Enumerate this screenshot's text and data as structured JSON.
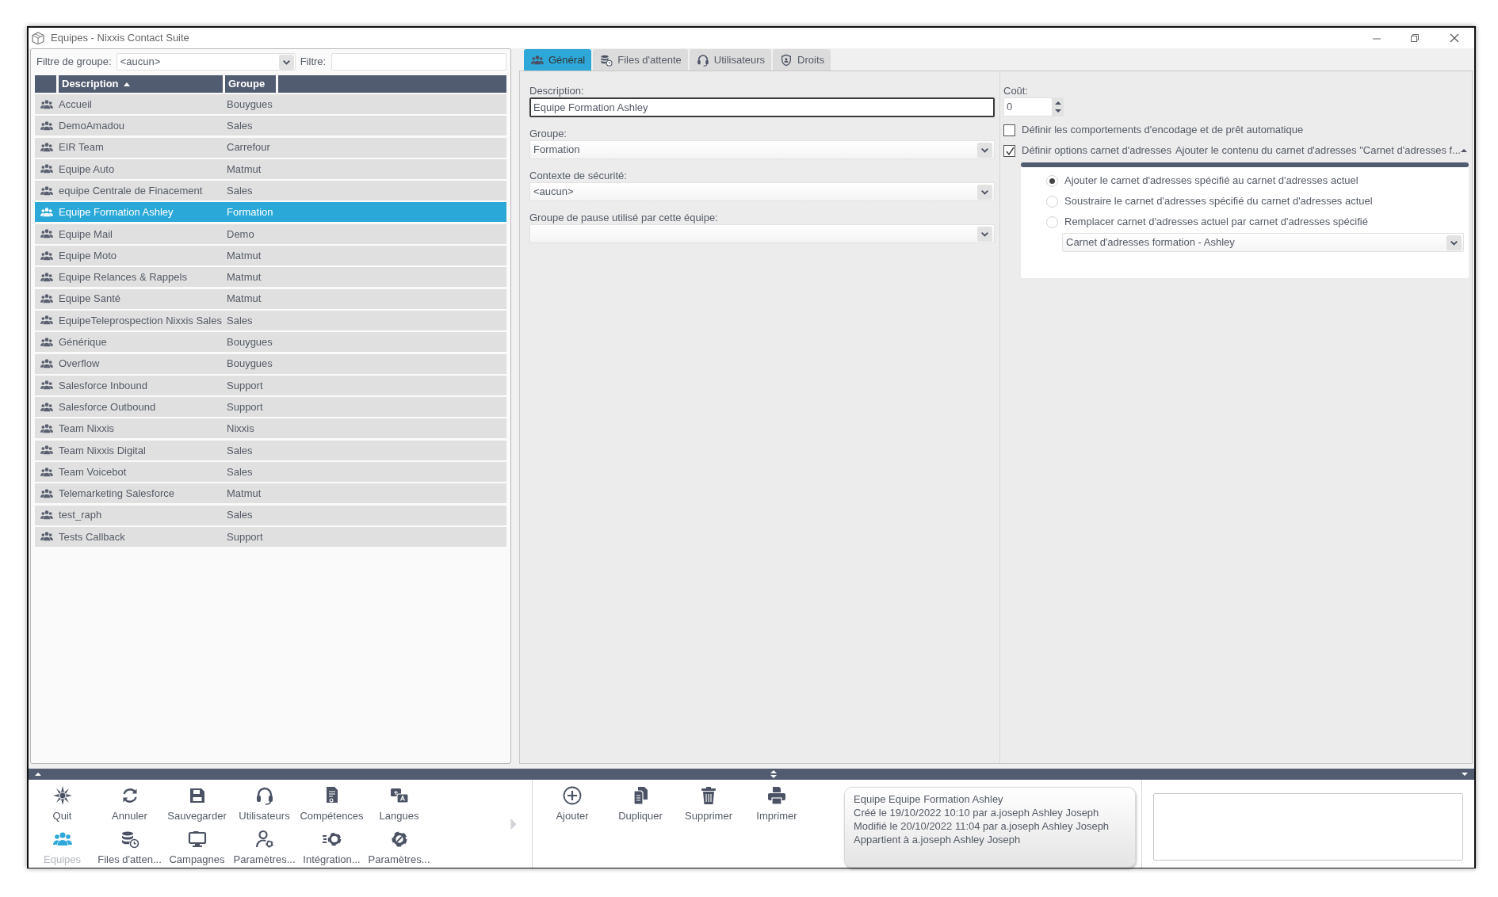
{
  "window": {
    "title": "Equipes - Nixxis Contact Suite"
  },
  "filter_bar": {
    "group_filter_label": "Filtre de groupe:",
    "group_filter_value": "<aucun>",
    "filter_label": "Filtre:"
  },
  "table": {
    "columns": [
      {
        "label": "Description",
        "sorted": true
      },
      {
        "label": "Groupe",
        "sorted": false
      }
    ],
    "rows": [
      {
        "description": "Accueil",
        "group": "Bouygues",
        "selected": false
      },
      {
        "description": "DemoAmadou",
        "group": "Sales",
        "selected": false
      },
      {
        "description": "EIR Team",
        "group": "Carrefour",
        "selected": false
      },
      {
        "description": "Equipe Auto",
        "group": "Matmut",
        "selected": false
      },
      {
        "description": "equipe Centrale de Finacement",
        "group": "Sales",
        "selected": false
      },
      {
        "description": "Equipe Formation Ashley",
        "group": "Formation",
        "selected": true
      },
      {
        "description": "Equipe Mail",
        "group": "Demo",
        "selected": false
      },
      {
        "description": "Equipe Moto",
        "group": "Matmut",
        "selected": false
      },
      {
        "description": "Equipe Relances & Rappels",
        "group": "Matmut",
        "selected": false
      },
      {
        "description": "Equipe Santé",
        "group": "Matmut",
        "selected": false
      },
      {
        "description": "EquipeTeleprospection Nixxis Sales",
        "group": "Sales",
        "selected": false
      },
      {
        "description": "Générique",
        "group": "Bouygues",
        "selected": false
      },
      {
        "description": "Overflow",
        "group": "Bouygues",
        "selected": false
      },
      {
        "description": "Salesforce Inbound",
        "group": "Support",
        "selected": false
      },
      {
        "description": "Salesforce Outbound",
        "group": "Support",
        "selected": false
      },
      {
        "description": "Team Nixxis",
        "group": "Nixxis",
        "selected": false
      },
      {
        "description": "Team Nixxis Digital",
        "group": "Sales",
        "selected": false
      },
      {
        "description": "Team Voicebot",
        "group": "Sales",
        "selected": false
      },
      {
        "description": "Telemarketing Salesforce",
        "group": "Matmut",
        "selected": false
      },
      {
        "description": "test_raph",
        "group": "Sales",
        "selected": false
      },
      {
        "description": "Tests Callback",
        "group": "Support",
        "selected": false
      }
    ]
  },
  "tabs": [
    {
      "label": "Général",
      "kind": "people",
      "selected": true
    },
    {
      "label": "Files d'attente",
      "kind": "database",
      "selected": false
    },
    {
      "label": "Utilisateurs",
      "kind": "headset",
      "selected": false
    },
    {
      "label": "Droits",
      "kind": "shield",
      "selected": false
    }
  ],
  "general": {
    "fields": [
      {
        "label": "Description:",
        "value": "Equipe Formation Ashley",
        "kind": "input"
      },
      {
        "label": "Groupe:",
        "value": "Formation",
        "kind": "select"
      },
      {
        "label": "Contexte de sécurité:",
        "value": "<aucun>",
        "kind": "select"
      },
      {
        "label": "Groupe de pause utilisé par cette équipe:",
        "kind": "select"
      }
    ],
    "cost": {
      "label": "Coût:",
      "value": "0"
    },
    "options": [
      {
        "label": "Définir les comportements d'encodage et de prêt automatique",
        "checked": false
      },
      {
        "label": "Définir options carnet d'adresses",
        "checked": true,
        "summary": "Ajouter le contenu du carnet d'adresses \"Carnet d'adresses f...",
        "expanded": true
      }
    ],
    "address_book": {
      "radios": [
        {
          "label": "Ajouter le carnet d'adresses spécifié au carnet d'adresses actuel",
          "selected": true
        },
        {
          "label": "Soustraire le carnet d'adresses spécifié du carnet d'adresses actuel",
          "selected": false
        },
        {
          "label": "Remplacer carnet d'adresses actuel par carnet d'adresses spécifié",
          "selected": false
        }
      ],
      "select_value": "Carnet d'adresses formation - Ashley"
    }
  },
  "toolbar": {
    "buttons": [
      {
        "label": "Quit",
        "kind": "starburst",
        "selected": false
      },
      {
        "label": "Annuler",
        "kind": "refresh",
        "selected": false
      },
      {
        "label": "Sauvegarder",
        "kind": "save",
        "selected": false
      },
      {
        "label": "Utilisateurs",
        "kind": "headset",
        "selected": false
      },
      {
        "label": "Compétences",
        "kind": "certificate",
        "selected": false
      },
      {
        "label": "Langues",
        "kind": "language",
        "selected": false
      },
      {
        "label": "Equipes",
        "kind": "people",
        "selected": true
      },
      {
        "label": "Files d'atten...",
        "kind": "database",
        "selected": false
      },
      {
        "label": "Campagnes",
        "kind": "monitor",
        "selected": false
      },
      {
        "label": "Paramètres...",
        "kind": "user-gear",
        "selected": false
      },
      {
        "label": "Intégration...",
        "kind": "gear-speed",
        "selected": false
      },
      {
        "label": "Paramètres...",
        "kind": "gear-wrench",
        "selected": false
      }
    ],
    "actions": [
      {
        "label": "Ajouter",
        "kind": "add"
      },
      {
        "label": "Dupliquer",
        "kind": "copy"
      },
      {
        "label": "Supprimer",
        "kind": "trash"
      },
      {
        "label": "Imprimer",
        "kind": "printer"
      }
    ]
  },
  "info": {
    "lines": [
      "Equipe Equipe Formation Ashley",
      "Créé le 19/10/2022 10:10 par a.joseph Ashley Joseph",
      "Modifié le 20/10/2022 11:04 par a.joseph Ashley Joseph",
      "Appartient à a.joseph Ashley Joseph"
    ]
  }
}
